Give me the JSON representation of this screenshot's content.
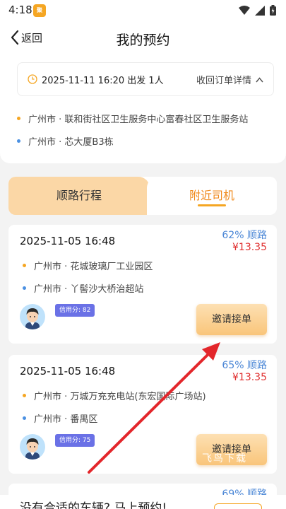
{
  "status_bar": {
    "time": "4:18",
    "notif_label": "聚"
  },
  "header": {
    "back_label": "返回",
    "title": "我的预约"
  },
  "trip": {
    "datetime": "2025-11-11 16:20 出发 1人",
    "collapse_label": "收回订单详情",
    "from": "广州市 · 联和街社区卫生服务中心富春社区卫生服务站",
    "to": "广州市 · 芯大厦B3栋"
  },
  "tabs": {
    "left": "顺路行程",
    "right": "附近司机",
    "active": "right"
  },
  "drivers": [
    {
      "time": "2025-11-05 16:48",
      "match": "62% 顺路",
      "price": "¥13.35",
      "from": "广州市 · 花城玻璃厂工业园区",
      "to": "广州市 · 丫髻沙大桥治超站",
      "credit": "信用分: 82",
      "action": "邀请接单"
    },
    {
      "time": "2025-11-05 16:48",
      "match": "65% 顺路",
      "price": "¥13.35",
      "from": "广州市 · 万城万充充电站(东宏国际广场站)",
      "to": "广州市 · 番禺区",
      "credit": "信用分: 75",
      "action": "邀请接单"
    }
  ],
  "third_card": {
    "match": "69% 顺路"
  },
  "bottom_banner": {
    "text": "没有合适的车辆? 马上预约!"
  },
  "watermark": "飞鸟下载",
  "colors": {
    "accent": "#f5a623",
    "price": "#e03030",
    "match": "#4a86d6",
    "credit": "#6a71e6"
  }
}
